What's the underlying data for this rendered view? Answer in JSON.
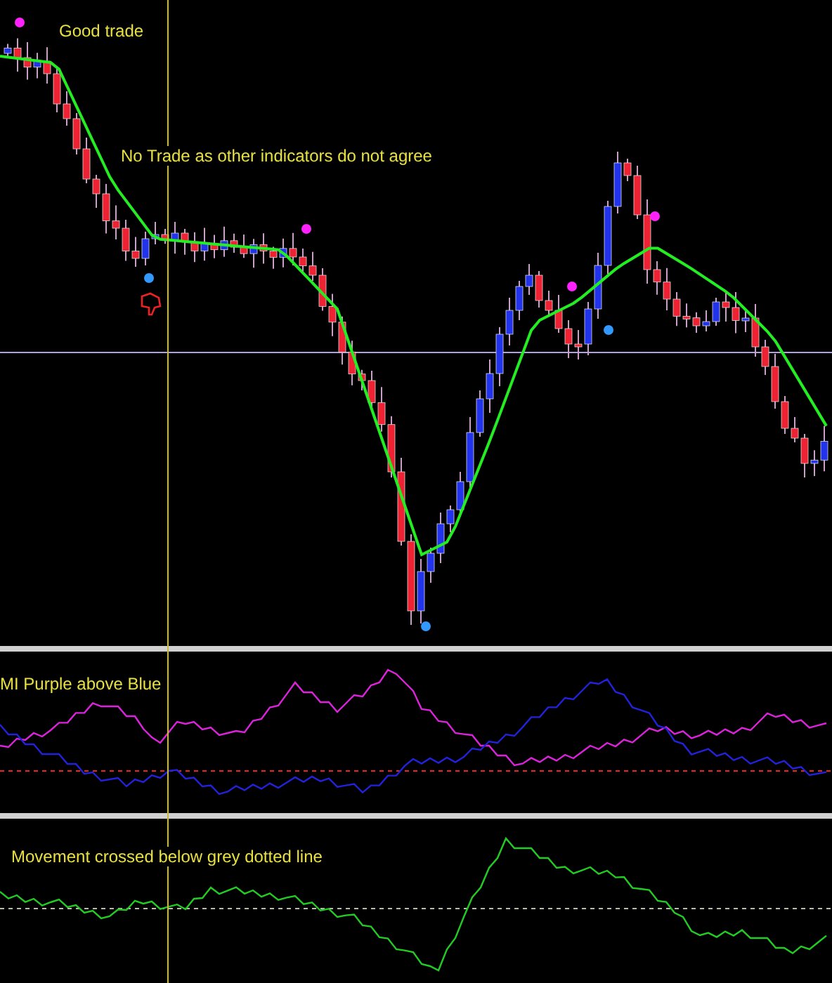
{
  "main_chart": {
    "annotations": [
      {
        "text": "Good trade"
      },
      {
        "text": "No Trade as other indicators do not agree"
      }
    ]
  },
  "dmi_panel": {
    "label": "MI Purple above Blue"
  },
  "movement_panel": {
    "label": "Movement crossed below grey dotted line"
  }
}
